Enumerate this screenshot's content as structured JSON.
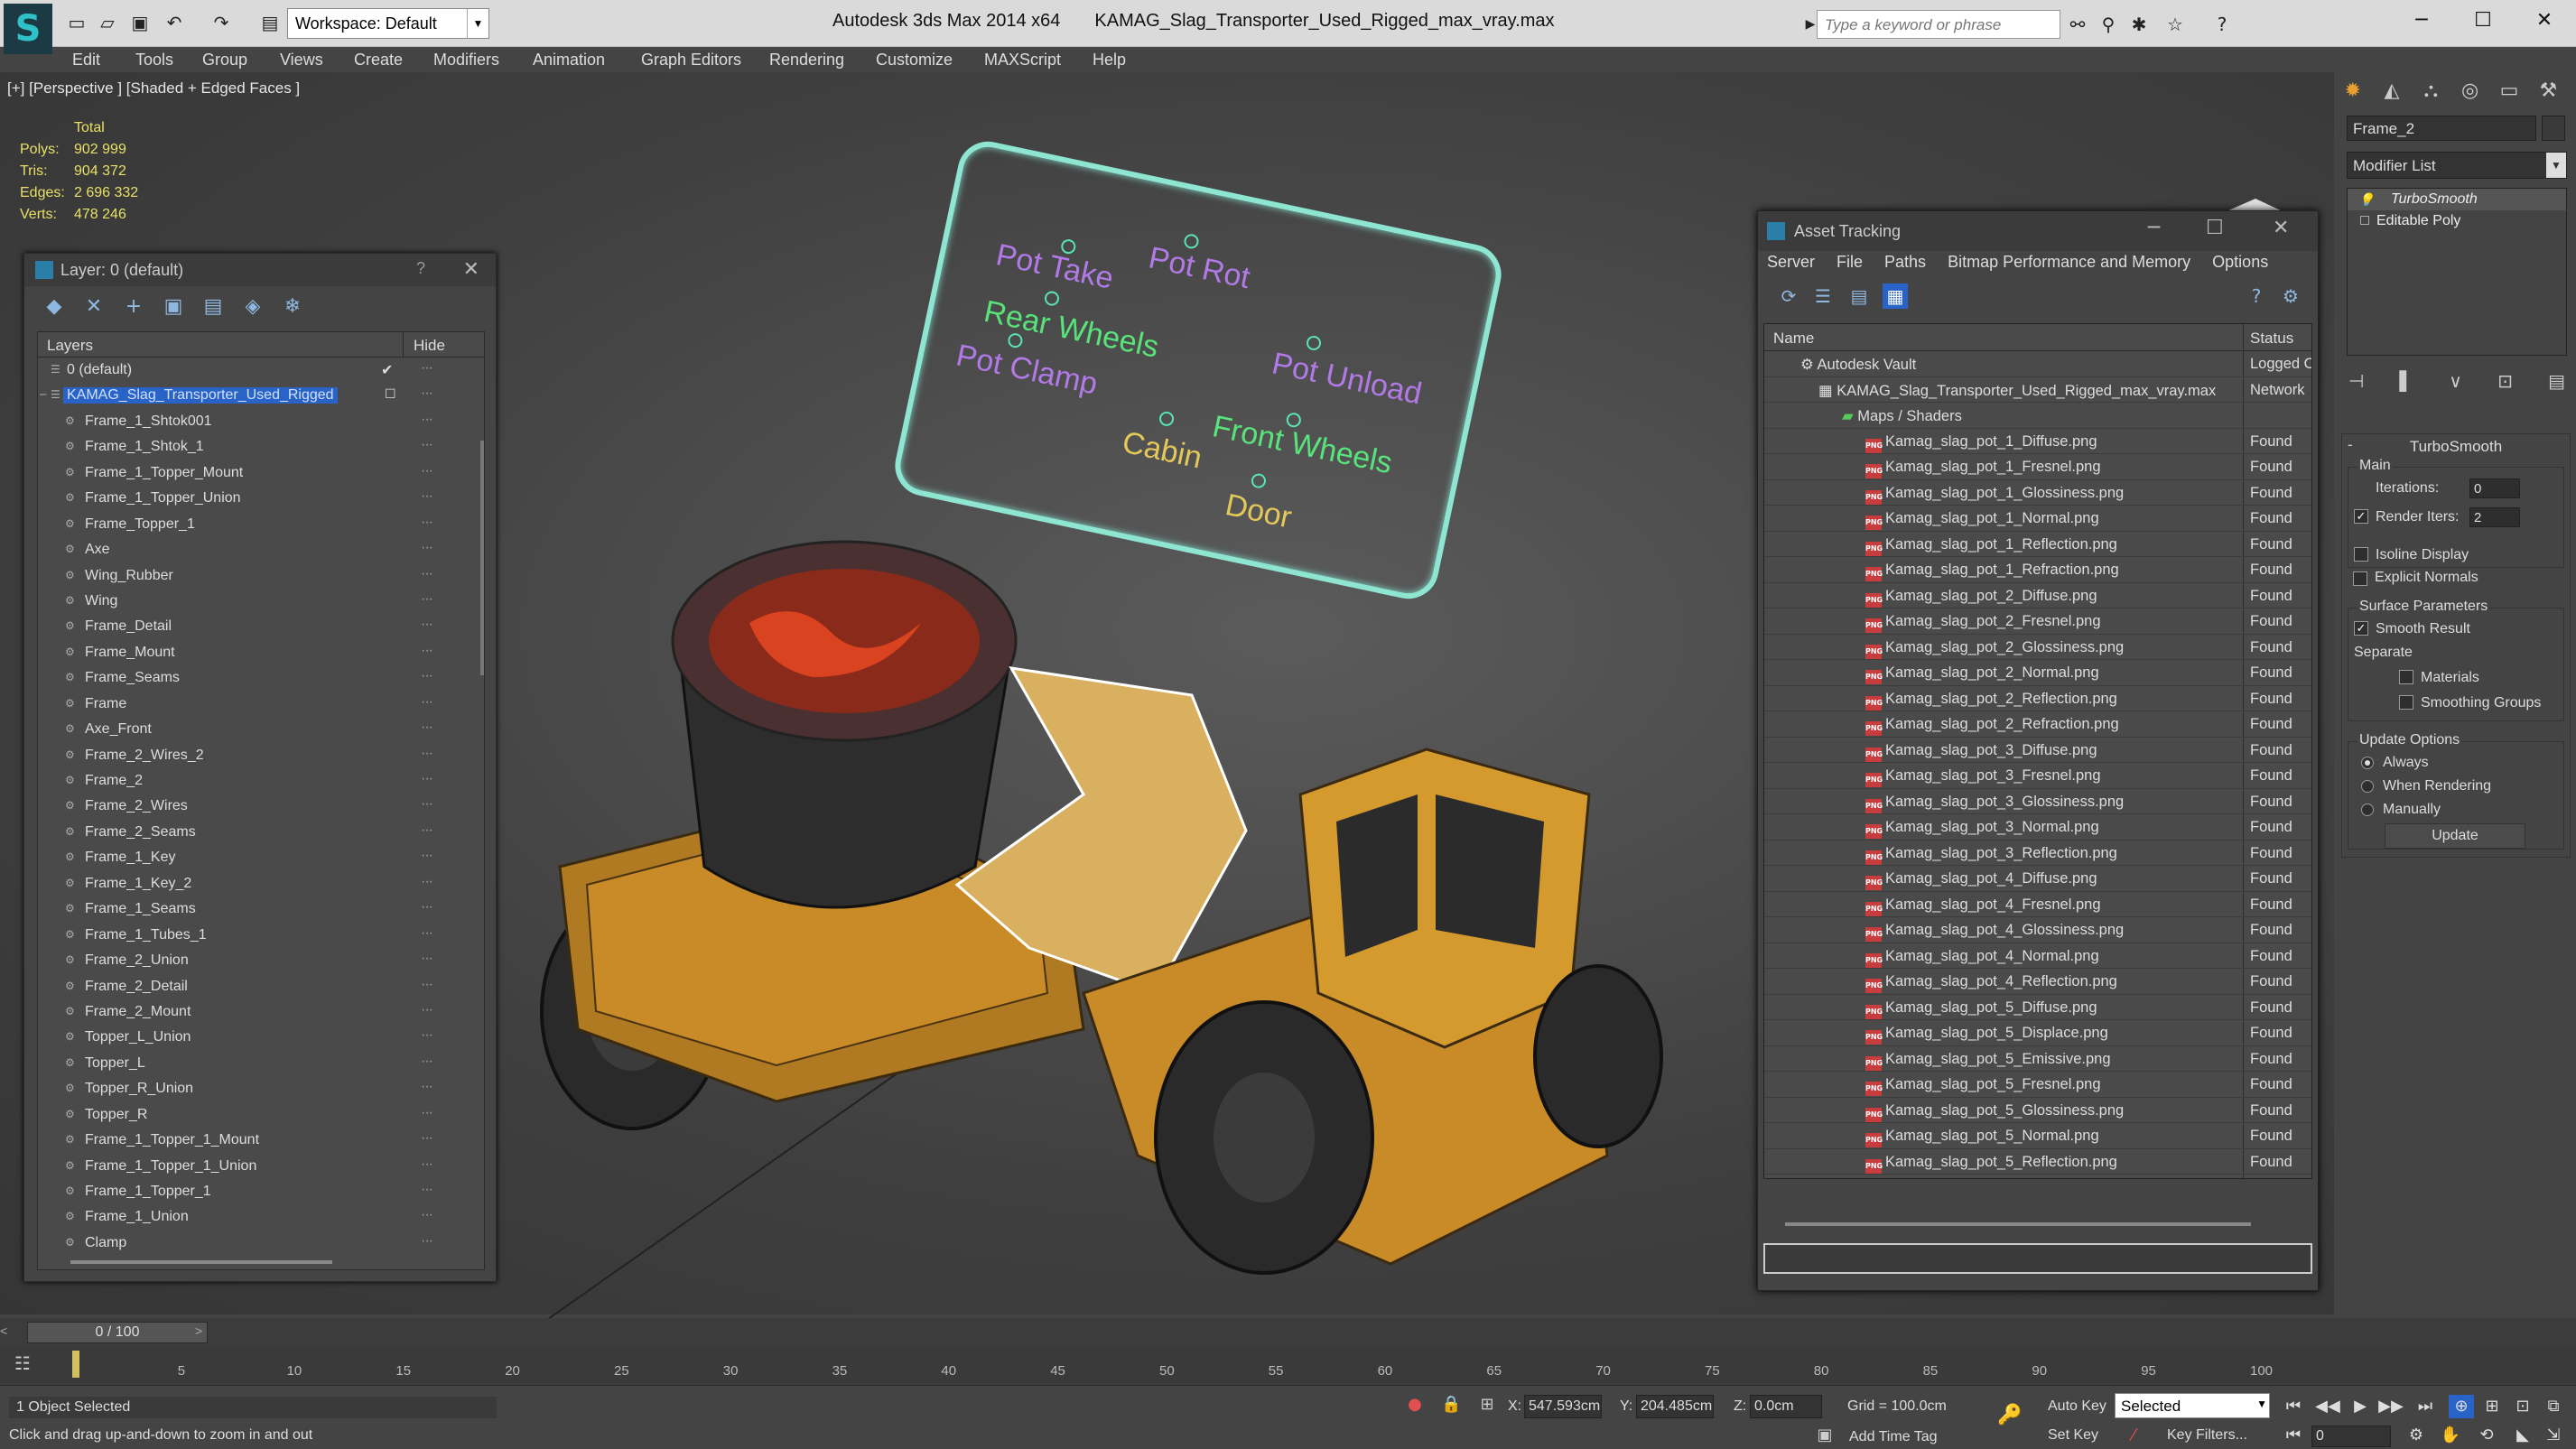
{
  "titlebar": {
    "workspace_label": "Workspace: Default",
    "app_name": "Autodesk 3ds Max  2014 x64",
    "file_name": "KAMAG_Slag_Transporter_Used_Rigged_max_vray.max",
    "search_placeholder": "Type a keyword or phrase"
  },
  "menu": [
    "Edit",
    "Tools",
    "Group",
    "Views",
    "Create",
    "Modifiers",
    "Animation",
    "Graph Editors",
    "Rendering",
    "Customize",
    "MAXScript",
    "Help"
  ],
  "viewport": {
    "label": "[+] [Perspective ] [Shaded + Edged Faces ]",
    "stats": {
      "total_label": "Total",
      "rows": [
        {
          "k": "Polys:",
          "v": "902 999"
        },
        {
          "k": "Tris:",
          "v": "904 372"
        },
        {
          "k": "Edges:",
          "v": "2 696 332"
        },
        {
          "k": "Verts:",
          "v": "478 246"
        }
      ]
    },
    "billboard_labels": [
      "Pot Rot",
      "Pot Take",
      "Pot Unload",
      "Rear Wheels",
      "Front Wheels",
      "Pot Clamp",
      "Cabin",
      "Door"
    ]
  },
  "layer_panel": {
    "title": "Layer: 0 (default)",
    "help": "?",
    "col_layers": "Layers",
    "col_hide": "Hide",
    "default_layer": "0 (default)",
    "selected_layer": "KAMAG_Slag_Transporter_Used_Rigged",
    "items": [
      "Frame_1_Shtok001",
      "Frame_1_Shtok_1",
      "Frame_1_Topper_Mount",
      "Frame_1_Topper_Union",
      "Frame_Topper_1",
      "Axe",
      "Wing_Rubber",
      "Wing",
      "Frame_Detail",
      "Frame_Mount",
      "Frame_Seams",
      "Frame",
      "Axe_Front",
      "Frame_2_Wires_2",
      "Frame_2",
      "Frame_2_Wires",
      "Frame_2_Seams",
      "Frame_1_Key",
      "Frame_1_Key_2",
      "Frame_1_Seams",
      "Frame_1_Tubes_1",
      "Frame_2_Union",
      "Frame_2_Detail",
      "Frame_2_Mount",
      "Topper_L_Union",
      "Topper_L",
      "Topper_R_Union",
      "Topper_R",
      "Frame_1_Topper_1_Mount",
      "Frame_1_Topper_1_Union",
      "Frame_1_Topper_1",
      "Frame_1_Union",
      "Clamp"
    ]
  },
  "asset_tracking": {
    "title": "Asset Tracking",
    "menu": [
      "Server",
      "File",
      "Paths",
      "Bitmap Performance and Memory",
      "Options"
    ],
    "col_name": "Name",
    "col_status": "Status",
    "vault": {
      "name": "Autodesk Vault",
      "status": "Logged Out"
    },
    "scene": {
      "name": "KAMAG_Slag_Transporter_Used_Rigged_max_vray.max",
      "status": "Network"
    },
    "maps_folder": "Maps / Shaders",
    "files": [
      "Kamag_slag_pot_1_Diffuse.png",
      "Kamag_slag_pot_1_Fresnel.png",
      "Kamag_slag_pot_1_Glossiness.png",
      "Kamag_slag_pot_1_Normal.png",
      "Kamag_slag_pot_1_Reflection.png",
      "Kamag_slag_pot_1_Refraction.png",
      "Kamag_slag_pot_2_Diffuse.png",
      "Kamag_slag_pot_2_Fresnel.png",
      "Kamag_slag_pot_2_Glossiness.png",
      "Kamag_slag_pot_2_Normal.png",
      "Kamag_slag_pot_2_Reflection.png",
      "Kamag_slag_pot_2_Refraction.png",
      "Kamag_slag_pot_3_Diffuse.png",
      "Kamag_slag_pot_3_Fresnel.png",
      "Kamag_slag_pot_3_Glossiness.png",
      "Kamag_slag_pot_3_Normal.png",
      "Kamag_slag_pot_3_Reflection.png",
      "Kamag_slag_pot_4_Diffuse.png",
      "Kamag_slag_pot_4_Fresnel.png",
      "Kamag_slag_pot_4_Glossiness.png",
      "Kamag_slag_pot_4_Normal.png",
      "Kamag_slag_pot_4_Reflection.png",
      "Kamag_slag_pot_5_Diffuse.png",
      "Kamag_slag_pot_5_Displace.png",
      "Kamag_slag_pot_5_Emissive.png",
      "Kamag_slag_pot_5_Fresnel.png",
      "Kamag_slag_pot_5_Glossiness.png",
      "Kamag_slag_pot_5_Normal.png",
      "Kamag_slag_pot_5_Reflection.png"
    ],
    "file_status": "Found"
  },
  "command_panel": {
    "object_name": "Frame_2",
    "modifier_list": "Modifier List",
    "stack": [
      "TurboSmooth",
      "Editable Poly"
    ],
    "rollout_title": "TurboSmooth",
    "main_label": "Main",
    "iterations_label": "Iterations:",
    "iterations_value": "0",
    "render_iters_label": "Render Iters:",
    "render_iters_value": "2",
    "isoline": "Isoline Display",
    "explicit_normals": "Explicit Normals",
    "surface_params": "Surface Parameters",
    "smooth_result": "Smooth Result",
    "separate": "Separate",
    "materials": "Materials",
    "smoothing_groups": "Smoothing Groups",
    "update_options": "Update Options",
    "always": "Always",
    "when_rendering": "When Rendering",
    "manually": "Manually",
    "update_btn": "Update"
  },
  "timeline": {
    "frame_display": "0 / 100",
    "ticks": [
      "5",
      "10",
      "15",
      "20",
      "25",
      "30",
      "35",
      "40",
      "45",
      "50",
      "55",
      "60",
      "65",
      "70",
      "75",
      "80",
      "85",
      "90",
      "95",
      "100"
    ]
  },
  "status": {
    "selection": "1 Object Selected",
    "prompt": "Click and drag up-and-down to zoom in and out",
    "x_label": "X:",
    "x_value": "547.593cm",
    "y_label": "Y:",
    "y_value": "204.485cm",
    "z_label": "Z:",
    "z_value": "0.0cm",
    "grid": "Grid = 100.0cm",
    "add_time_tag": "Add Time Tag",
    "auto_key": "Auto Key",
    "set_key": "Set Key",
    "key_mode": "Selected",
    "key_filters": "Key Filters...",
    "current_frame": "0"
  },
  "colors": {
    "accent_blue": "#2a63c8",
    "stats_yellow": "#e8e066",
    "billboard": "#8ee6d2",
    "truck_orange": "#d49a2e"
  }
}
